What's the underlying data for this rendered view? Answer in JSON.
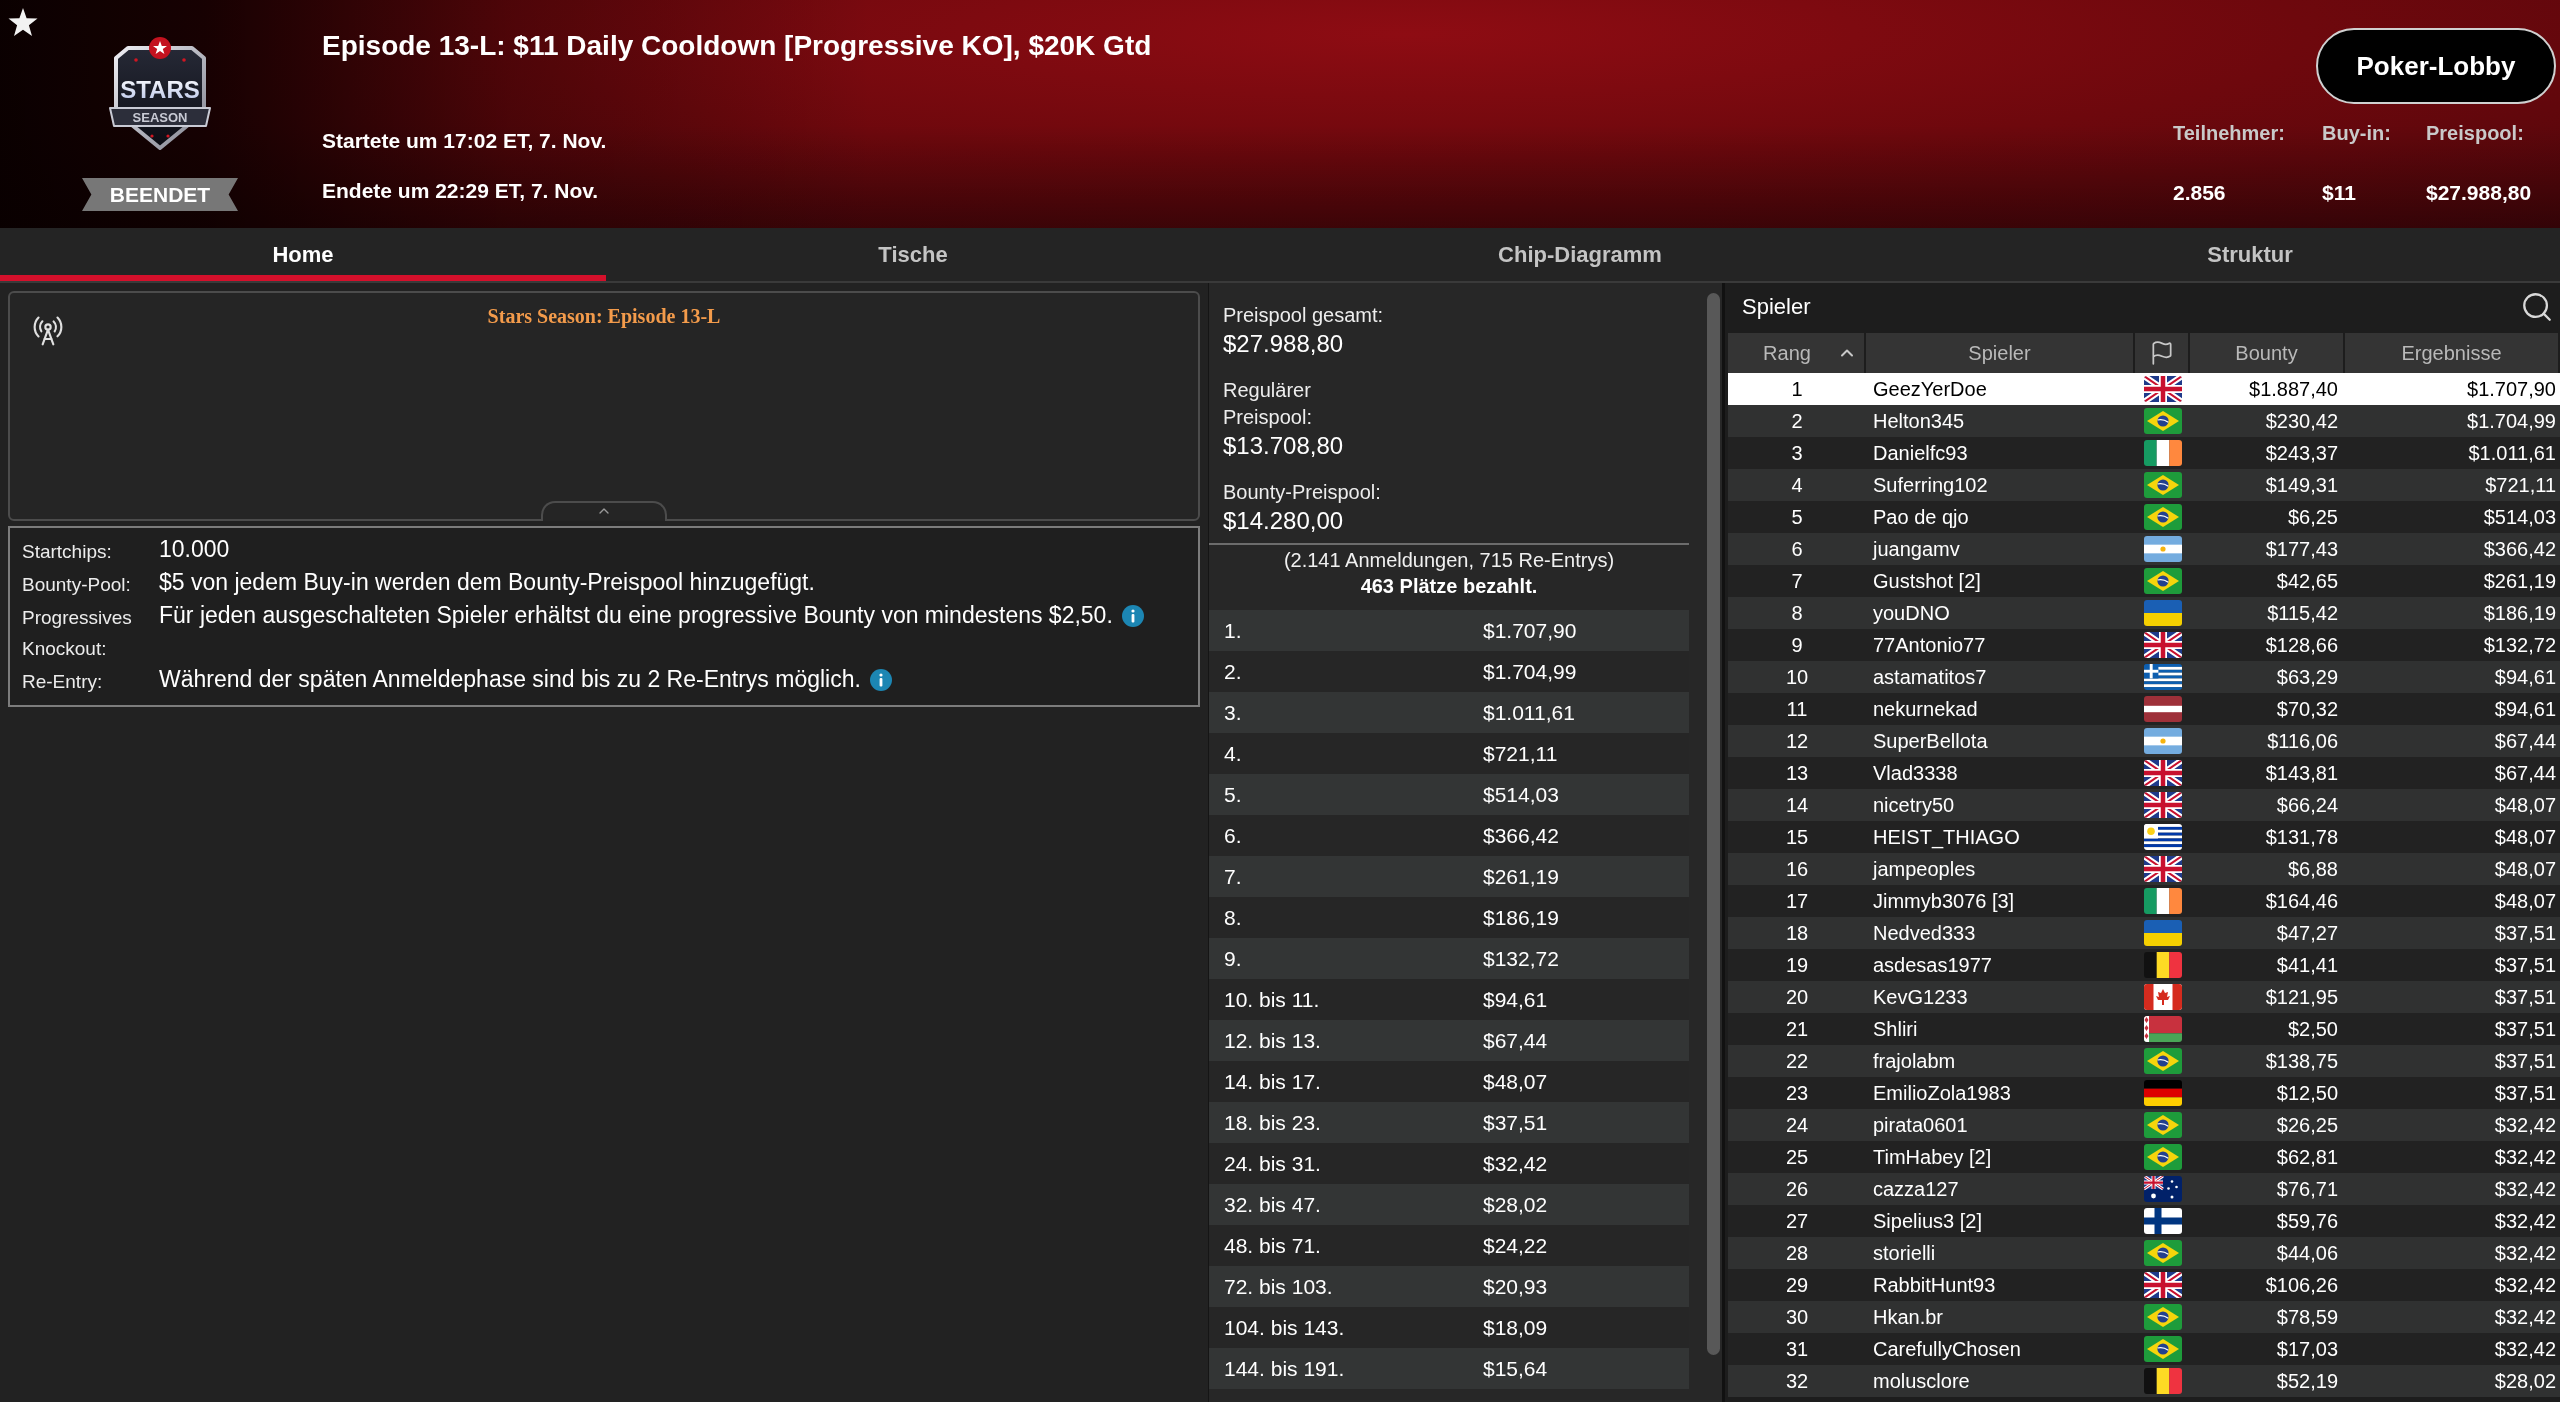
{
  "header": {
    "logo": {
      "top": "STARS",
      "bottom": "SEASON"
    },
    "status": "BEENDET",
    "title": "Episode 13-L: $11 Daily Cooldown [Progressive KO], $20K Gtd",
    "started": "Startete um 17:02 ET, 7. Nov.",
    "ended": "Endete um 22:29 ET, 7. Nov.",
    "lobby_button": "Poker-Lobby",
    "stats": [
      {
        "label": "Teilnehmer:",
        "value": "2.856"
      },
      {
        "label": "Buy-in:",
        "value": "$11"
      },
      {
        "label": "Preispool:",
        "value": "$27.988,80"
      }
    ]
  },
  "tabs": [
    {
      "label": "Home",
      "selected": true
    },
    {
      "label": "Tische",
      "selected": false
    },
    {
      "label": "Chip-Diagramm",
      "selected": false
    },
    {
      "label": "Struktur",
      "selected": false
    }
  ],
  "broadcast": {
    "title": "Stars Season: Episode 13-L"
  },
  "details": [
    {
      "label": "Startchips:",
      "value": "10.000",
      "info_icon": false
    },
    {
      "label": "Bounty-Pool:",
      "value": "$5 von jedem Buy-in werden dem Bounty-Preispool hinzugefügt.",
      "info_icon": false
    },
    {
      "label": "Progressives Knockout:",
      "value": "Für jeden ausgeschalteten Spieler erhältst du eine progressive Bounty von mindestens $2,50.",
      "info_icon": true
    },
    {
      "label": "Re-Entry:",
      "value": "Während der späten Anmeldephase sind bis zu 2 Re-Entrys möglich.",
      "info_icon": true
    }
  ],
  "prize_pool": {
    "totals": [
      {
        "label": "Preispool gesamt:",
        "value": "$27.988,80"
      },
      {
        "label": "Regulärer\nPreispool:",
        "value": "$13.708,80"
      },
      {
        "label": "Bounty-Preispool:",
        "value": "$14.280,00"
      }
    ],
    "entries": "(2.141 Anmeldungen, 715 Re-Entrys)",
    "paid": "463 Plätze bezahlt.",
    "payouts": [
      {
        "place": "1.",
        "amount": "$1.707,90"
      },
      {
        "place": "2.",
        "amount": "$1.704,99"
      },
      {
        "place": "3.",
        "amount": "$1.011,61"
      },
      {
        "place": "4.",
        "amount": "$721,11"
      },
      {
        "place": "5.",
        "amount": "$514,03"
      },
      {
        "place": "6.",
        "amount": "$366,42"
      },
      {
        "place": "7.",
        "amount": "$261,19"
      },
      {
        "place": "8.",
        "amount": "$186,19"
      },
      {
        "place": "9.",
        "amount": "$132,72"
      },
      {
        "place": "10. bis 11.",
        "amount": "$94,61"
      },
      {
        "place": "12. bis 13.",
        "amount": "$67,44"
      },
      {
        "place": "14. bis 17.",
        "amount": "$48,07"
      },
      {
        "place": "18. bis 23.",
        "amount": "$37,51"
      },
      {
        "place": "24. bis 31.",
        "amount": "$32,42"
      },
      {
        "place": "32. bis 47.",
        "amount": "$28,02"
      },
      {
        "place": "48. bis 71.",
        "amount": "$24,22"
      },
      {
        "place": "72. bis 103.",
        "amount": "$20,93"
      },
      {
        "place": "104. bis 143.",
        "amount": "$18,09"
      },
      {
        "place": "144. bis 191.",
        "amount": "$15,64"
      }
    ]
  },
  "players": {
    "title": "Spieler",
    "columns": [
      {
        "kind": "text",
        "label": "Rang",
        "sorted": true
      },
      {
        "kind": "text",
        "label": "Spieler",
        "sorted": false
      },
      {
        "kind": "flag",
        "sorted": false
      },
      {
        "kind": "text",
        "label": "Bounty",
        "sorted": false
      },
      {
        "kind": "text",
        "label": "Ergebnisse",
        "sorted": false
      }
    ],
    "rows": [
      {
        "rank": "1",
        "name": "GeezYerDoe",
        "flag": {
          "kind": "uk"
        },
        "bounty": "$1.887,40",
        "result": "$1.707,90",
        "selected": true
      },
      {
        "rank": "2",
        "name": "Helton345",
        "flag": {
          "kind": "brazil"
        },
        "bounty": "$230,42",
        "result": "$1.704,99",
        "selected": false
      },
      {
        "rank": "3",
        "name": "Danielfc93",
        "flag": {
          "kind": "ireland"
        },
        "bounty": "$243,37",
        "result": "$1.011,61",
        "selected": false
      },
      {
        "rank": "4",
        "name": "Suferring102",
        "flag": {
          "kind": "brazil"
        },
        "bounty": "$149,31",
        "result": "$721,11",
        "selected": false
      },
      {
        "rank": "5",
        "name": "Pao de qjo",
        "flag": {
          "kind": "brazil"
        },
        "bounty": "$6,25",
        "result": "$514,03",
        "selected": false
      },
      {
        "rank": "6",
        "name": "juangamv",
        "flag": {
          "kind": "argentina"
        },
        "bounty": "$177,43",
        "result": "$366,42",
        "selected": false
      },
      {
        "rank": "7",
        "name": "Gustshot [2]",
        "flag": {
          "kind": "brazil"
        },
        "bounty": "$42,65",
        "result": "$261,19",
        "selected": false
      },
      {
        "rank": "8",
        "name": "youDNO",
        "flag": {
          "kind": "ukraine"
        },
        "bounty": "$115,42",
        "result": "$186,19",
        "selected": false
      },
      {
        "rank": "9",
        "name": "77Antonio77",
        "flag": {
          "kind": "uk"
        },
        "bounty": "$128,66",
        "result": "$132,72",
        "selected": false
      },
      {
        "rank": "10",
        "name": "astamatitos7",
        "flag": {
          "kind": "greece"
        },
        "bounty": "$63,29",
        "result": "$94,61",
        "selected": false
      },
      {
        "rank": "11",
        "name": "nekurnekad",
        "flag": {
          "kind": "latvia"
        },
        "bounty": "$70,32",
        "result": "$94,61",
        "selected": false
      },
      {
        "rank": "12",
        "name": "SuperBellota",
        "flag": {
          "kind": "argentina"
        },
        "bounty": "$116,06",
        "result": "$67,44",
        "selected": false
      },
      {
        "rank": "13",
        "name": "Vlad3338",
        "flag": {
          "kind": "uk"
        },
        "bounty": "$143,81",
        "result": "$67,44",
        "selected": false
      },
      {
        "rank": "14",
        "name": "nicetry50",
        "flag": {
          "kind": "uk"
        },
        "bounty": "$66,24",
        "result": "$48,07",
        "selected": false
      },
      {
        "rank": "15",
        "name": "HEIST_THIAGO",
        "flag": {
          "kind": "uruguay"
        },
        "bounty": "$131,78",
        "result": "$48,07",
        "selected": false
      },
      {
        "rank": "16",
        "name": "jampeoples",
        "flag": {
          "kind": "uk"
        },
        "bounty": "$6,88",
        "result": "$48,07",
        "selected": false
      },
      {
        "rank": "17",
        "name": "Jimmyb3076 [3]",
        "flag": {
          "kind": "ireland"
        },
        "bounty": "$164,46",
        "result": "$48,07",
        "selected": false
      },
      {
        "rank": "18",
        "name": "Nedved333",
        "flag": {
          "kind": "ukraine"
        },
        "bounty": "$47,27",
        "result": "$37,51",
        "selected": false
      },
      {
        "rank": "19",
        "name": "asdesas1977",
        "flag": {
          "kind": "belgium"
        },
        "bounty": "$41,41",
        "result": "$37,51",
        "selected": false
      },
      {
        "rank": "20",
        "name": "KevG1233",
        "flag": {
          "kind": "canada"
        },
        "bounty": "$121,95",
        "result": "$37,51",
        "selected": false
      },
      {
        "rank": "21",
        "name": "Shliri",
        "flag": {
          "kind": "belarus"
        },
        "bounty": "$2,50",
        "result": "$37,51",
        "selected": false
      },
      {
        "rank": "22",
        "name": "frajolabm",
        "flag": {
          "kind": "brazil"
        },
        "bounty": "$138,75",
        "result": "$37,51",
        "selected": false
      },
      {
        "rank": "23",
        "name": "EmilioZola1983",
        "flag": {
          "kind": "germany"
        },
        "bounty": "$12,50",
        "result": "$37,51",
        "selected": false
      },
      {
        "rank": "24",
        "name": "pirata0601",
        "flag": {
          "kind": "brazil"
        },
        "bounty": "$26,25",
        "result": "$32,42",
        "selected": false
      },
      {
        "rank": "25",
        "name": "TimHabey [2]",
        "flag": {
          "kind": "brazil"
        },
        "bounty": "$62,81",
        "result": "$32,42",
        "selected": false
      },
      {
        "rank": "26",
        "name": "cazza127",
        "flag": {
          "kind": "australia"
        },
        "bounty": "$76,71",
        "result": "$32,42",
        "selected": false
      },
      {
        "rank": "27",
        "name": "Sipelius3 [2]",
        "flag": {
          "kind": "finland"
        },
        "bounty": "$59,76",
        "result": "$32,42",
        "selected": false
      },
      {
        "rank": "28",
        "name": "storielli",
        "flag": {
          "kind": "brazil"
        },
        "bounty": "$44,06",
        "result": "$32,42",
        "selected": false
      },
      {
        "rank": "29",
        "name": "RabbitHunt93",
        "flag": {
          "kind": "uk"
        },
        "bounty": "$106,26",
        "result": "$32,42",
        "selected": false
      },
      {
        "rank": "30",
        "name": "Hkan.br",
        "flag": {
          "kind": "brazil"
        },
        "bounty": "$78,59",
        "result": "$32,42",
        "selected": false
      },
      {
        "rank": "31",
        "name": "CarefullyChosen",
        "flag": {
          "kind": "brazil"
        },
        "bounty": "$17,03",
        "result": "$32,42",
        "selected": false
      },
      {
        "rank": "32",
        "name": "molusclore",
        "flag": {
          "kind": "belgium"
        },
        "bounty": "$52,19",
        "result": "$28,02",
        "selected": false
      }
    ]
  }
}
